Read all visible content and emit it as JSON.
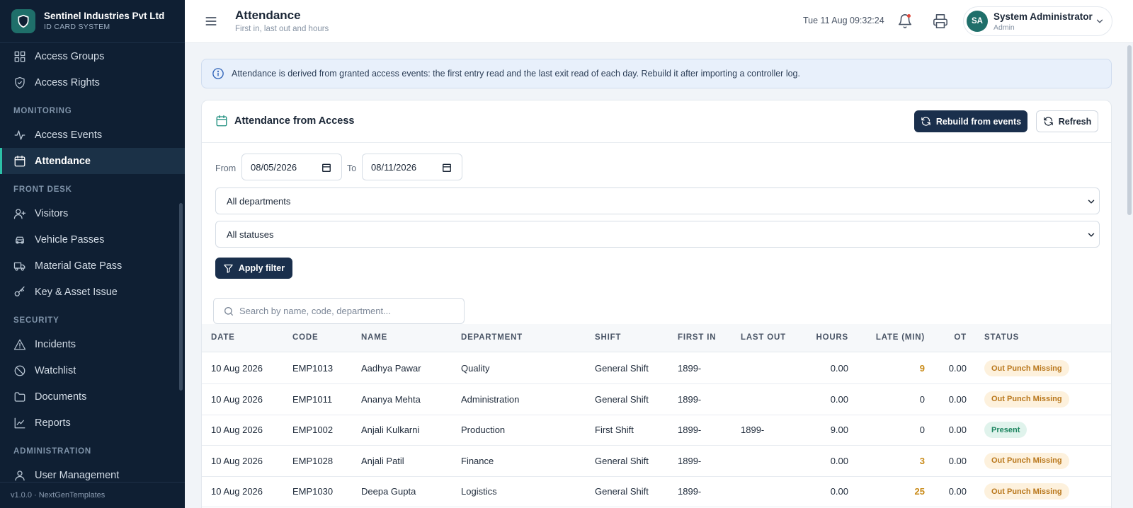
{
  "brand": {
    "name": "Sentinel Industries Pvt Ltd",
    "subtitle": "ID CARD SYSTEM"
  },
  "sidebar": {
    "items": [
      {
        "type": "item",
        "label": "Access Groups",
        "icon": "grid-icon",
        "active": false
      },
      {
        "type": "item",
        "label": "Access Rights",
        "icon": "shield-icon",
        "active": false
      },
      {
        "type": "section",
        "label": "MONITORING"
      },
      {
        "type": "item",
        "label": "Access Events",
        "icon": "activity-icon",
        "active": false
      },
      {
        "type": "item",
        "label": "Attendance",
        "icon": "calendar-icon",
        "active": true
      },
      {
        "type": "section",
        "label": "FRONT DESK"
      },
      {
        "type": "item",
        "label": "Visitors",
        "icon": "user-plus-icon",
        "active": false
      },
      {
        "type": "item",
        "label": "Vehicle Passes",
        "icon": "car-icon",
        "active": false
      },
      {
        "type": "item",
        "label": "Material Gate Pass",
        "icon": "truck-icon",
        "active": false
      },
      {
        "type": "item",
        "label": "Key & Asset Issue",
        "icon": "key-icon",
        "active": false
      },
      {
        "type": "section",
        "label": "SECURITY"
      },
      {
        "type": "item",
        "label": "Incidents",
        "icon": "alert-triangle-icon",
        "active": false
      },
      {
        "type": "item",
        "label": "Watchlist",
        "icon": "ban-icon",
        "active": false
      },
      {
        "type": "item",
        "label": "Documents",
        "icon": "folder-icon",
        "active": false
      },
      {
        "type": "item",
        "label": "Reports",
        "icon": "chart-line-icon",
        "active": false
      },
      {
        "type": "section",
        "label": "ADMINISTRATION"
      },
      {
        "type": "item",
        "label": "User Management",
        "icon": "user-icon",
        "active": false
      }
    ],
    "footer": "v1.0.0 · NextGenTemplates"
  },
  "header": {
    "title": "Attendance",
    "subtitle": "First in, last out and hours",
    "datetime": "Tue 11 Aug 09:32:24",
    "user": {
      "initials": "SA",
      "name": "System Administrator",
      "role": "Admin"
    }
  },
  "info_banner": "Attendance is derived from granted access events: the first entry read and the last exit read of each day. Rebuild it after importing a controller log.",
  "card": {
    "title": "Attendance from Access",
    "rebuild_label": "Rebuild from events",
    "refresh_label": "Refresh"
  },
  "filters": {
    "from_label": "From",
    "from_value": "08/05/2026",
    "to_label": "To",
    "to_value": "08/11/2026",
    "department": "All departments",
    "status": "All statuses",
    "apply_label": "Apply filter",
    "search_placeholder": "Search by name, code, department..."
  },
  "table": {
    "columns": [
      "DATE",
      "CODE",
      "NAME",
      "DEPARTMENT",
      "SHIFT",
      "FIRST IN",
      "LAST OUT",
      "HOURS",
      "LATE (MIN)",
      "OT",
      "STATUS"
    ],
    "rows": [
      {
        "date": "10 Aug 2026",
        "code": "EMP1013",
        "name": "Aadhya Pawar",
        "department": "Quality",
        "shift": "General Shift",
        "first_in": "1899-",
        "last_out": "",
        "hours": "0.00",
        "late": "9",
        "ot": "0.00",
        "status": "Out Punch Missing",
        "status_kind": "missing"
      },
      {
        "date": "10 Aug 2026",
        "code": "EMP1011",
        "name": "Ananya Mehta",
        "department": "Administration",
        "shift": "General Shift",
        "first_in": "1899-",
        "last_out": "",
        "hours": "0.00",
        "late": "0",
        "ot": "0.00",
        "status": "Out Punch Missing",
        "status_kind": "missing"
      },
      {
        "date": "10 Aug 2026",
        "code": "EMP1002",
        "name": "Anjali Kulkarni",
        "department": "Production",
        "shift": "First Shift",
        "first_in": "1899-",
        "last_out": "1899-",
        "hours": "9.00",
        "late": "0",
        "ot": "0.00",
        "status": "Present",
        "status_kind": "present"
      },
      {
        "date": "10 Aug 2026",
        "code": "EMP1028",
        "name": "Anjali Patil",
        "department": "Finance",
        "shift": "General Shift",
        "first_in": "1899-",
        "last_out": "",
        "hours": "0.00",
        "late": "3",
        "ot": "0.00",
        "status": "Out Punch Missing",
        "status_kind": "missing"
      },
      {
        "date": "10 Aug 2026",
        "code": "EMP1030",
        "name": "Deepa Gupta",
        "department": "Logistics",
        "shift": "General Shift",
        "first_in": "1899-",
        "last_out": "",
        "hours": "0.00",
        "late": "25",
        "ot": "0.00",
        "status": "Out Punch Missing",
        "status_kind": "missing"
      }
    ]
  },
  "colors": {
    "sidebar_bg": "#0f1f33",
    "accent": "#2cc1a8",
    "primary_button": "#1a2f4c",
    "late_text": "#c98a17"
  }
}
